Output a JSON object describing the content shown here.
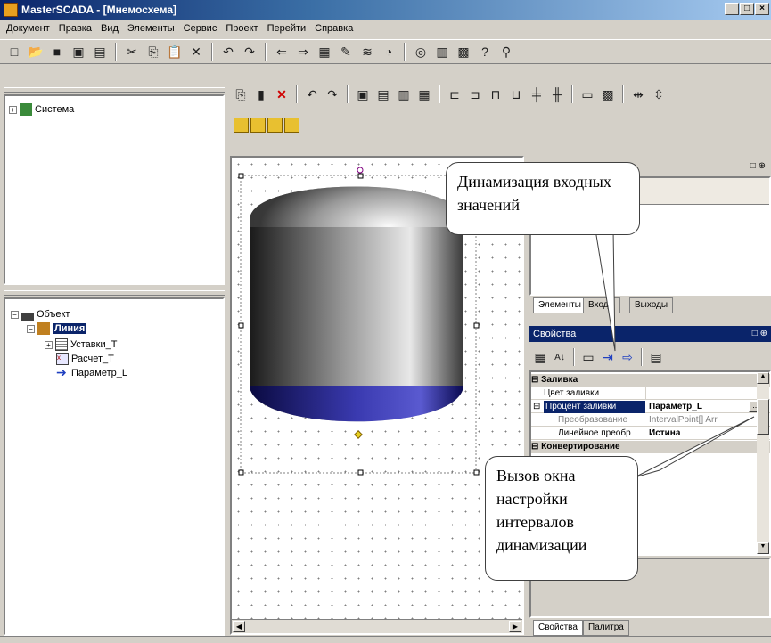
{
  "window": {
    "title": "MasterSCADA - [Мнемосхема]",
    "controls": [
      "_",
      "□",
      "×"
    ]
  },
  "menu": [
    "Документ",
    "Правка",
    "Вид",
    "Элементы",
    "Сервис",
    "Проект",
    "Перейти",
    "Справка"
  ],
  "system_tree": {
    "root_label": "Система"
  },
  "object_tree": {
    "root_label": "Объект",
    "line_label": "Линия",
    "children": [
      "Уставки_Т",
      "Расчет_Т",
      "Параметр_L"
    ]
  },
  "tabs_top": {
    "elements": "Элементы",
    "inputs": "Входы",
    "outputs": "Выходы"
  },
  "properties_panel": {
    "title": "Свойства",
    "group_fill": "Заливка",
    "rows": [
      {
        "name": "Цвет заливки",
        "value": ""
      },
      {
        "name": "Процент заливки",
        "value": "Параметр_L"
      },
      {
        "name": "Преобразование",
        "value": "IntervalPoint[] Arr"
      },
      {
        "name": "Линейное преобр",
        "value": "Истина"
      }
    ],
    "group_next": "Конвертирование",
    "ellipsis": "..."
  },
  "tabs_bottom": {
    "properties": "Свойства",
    "palette": "Палитра"
  },
  "callouts": {
    "dynamization": "Динамизация входных значений",
    "interval_window": "Вызов окна настройки интервалов динамизации"
  },
  "colors": {
    "titlebar": "#0a246a",
    "selection": "#0a246a",
    "tank_fill": "#2a2a9a"
  }
}
